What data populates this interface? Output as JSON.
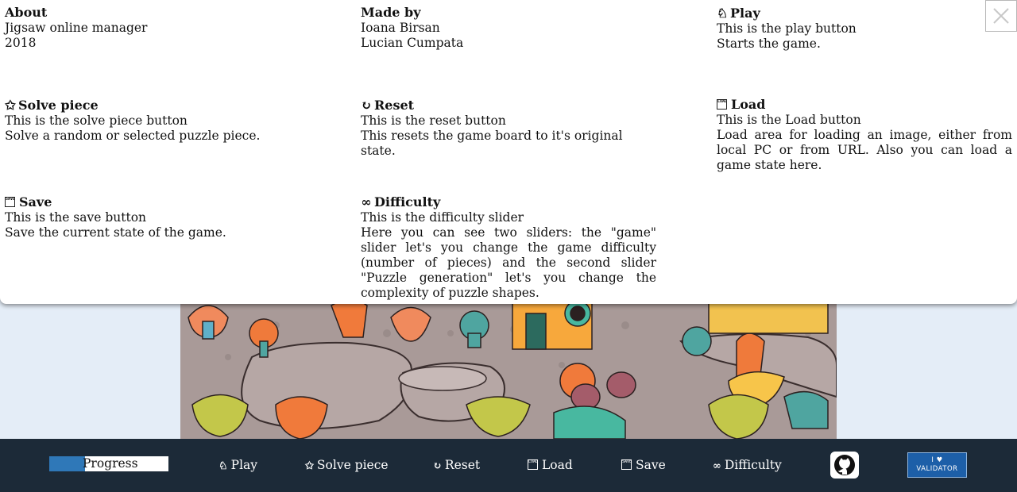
{
  "about": {
    "about_block": {
      "heading": "About",
      "lines": [
        "Jigsaw online manager",
        "2018"
      ]
    },
    "made_by_block": {
      "heading": "Made by",
      "lines": [
        "Ioana Birsan",
        "Lucian Cumpata"
      ]
    },
    "play_block": {
      "icon": "play-icon",
      "heading": "Play",
      "lines": [
        "This is the play button",
        "Starts the game."
      ]
    },
    "solve_block": {
      "icon": "star-icon",
      "heading": "Solve piece",
      "lines": [
        "This is the solve piece button",
        "Solve a random or selected puzzle piece."
      ]
    },
    "reset_block": {
      "icon": "reset-icon",
      "heading": "Reset",
      "lines": [
        "This is the reset button",
        "This resets the game board to it's original state."
      ]
    },
    "load_block": {
      "icon": "load-icon",
      "heading": "Load",
      "lines": [
        "This is the Load button",
        "Load area for loading an image, either from local PC or from URL. Also you can load a game state here."
      ]
    },
    "save_block": {
      "icon": "save-icon",
      "heading": "Save",
      "lines": [
        "This is the save button",
        "Save the current state of the game."
      ]
    },
    "difficulty_block": {
      "icon": "infinity-icon",
      "heading": "Difficulty",
      "lines": [
        "This is the difficulty slider",
        "Here you can see two sliders: the \"game\" slider let's you change the game difficulty (number of pieces) and the second slider \"Puzzle generation\" let's you change the complexity of puzzle shapes."
      ]
    }
  },
  "glyphs": {
    "play": "♘",
    "star": "✩",
    "reset": "↻",
    "infinity": "∞",
    "load_box": "LOAD",
    "save_box": "SAVE"
  },
  "toolbar": {
    "progress_label": "Progress",
    "progress_value": 0.3,
    "play_label": "Play",
    "solve_label": "Solve piece",
    "reset_label": "Reset",
    "load_label": "Load",
    "save_label": "Save",
    "difficulty_label": "Difficulty",
    "validator_line1": "I ♥",
    "validator_line2": "VALIDATOR"
  },
  "colors": {
    "toolbar_bg": "#1c2a38",
    "progress_fill": "#2f78b8",
    "page_bg": "#e4edf7",
    "validator_bg": "#1d5fa8"
  }
}
